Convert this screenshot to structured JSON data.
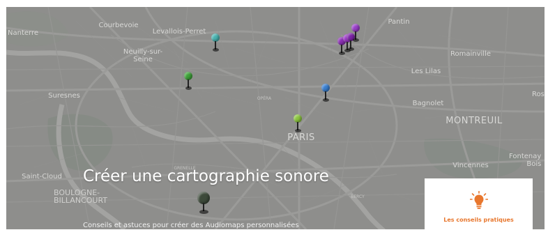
{
  "map": {
    "places": [
      {
        "id": "nanterre",
        "label": "Nanterre"
      },
      {
        "id": "courbevoie",
        "label": "Courbevoie"
      },
      {
        "id": "levallois",
        "label": "Levallois-Perret"
      },
      {
        "id": "neuilly",
        "label": "Neuilly-sur-\nSeine"
      },
      {
        "id": "pantin",
        "label": "Pantin"
      },
      {
        "id": "romainville",
        "label": "Romainville"
      },
      {
        "id": "leslilas",
        "label": "Les Lilas"
      },
      {
        "id": "suresnes",
        "label": "Suresnes"
      },
      {
        "id": "opera",
        "label": "OPÉRA"
      },
      {
        "id": "bagnolet",
        "label": "Bagnolet"
      },
      {
        "id": "montreuil",
        "label": "MONTREUIL"
      },
      {
        "id": "paris",
        "label": "PARIS"
      },
      {
        "id": "ros",
        "label": "Ros"
      },
      {
        "id": "saintcloud",
        "label": "Saint-Cloud"
      },
      {
        "id": "grenelle",
        "label": "GRENELLE"
      },
      {
        "id": "vincennes",
        "label": "Vincennes"
      },
      {
        "id": "fontenay",
        "label": "Fontenay\nBois"
      },
      {
        "id": "boulogne",
        "label": "BOULOGNE-\nBILLANCOURT"
      },
      {
        "id": "bercy",
        "label": "BERCY"
      }
    ],
    "pins": [
      {
        "id": "pin-teal",
        "color": "#49b3b0"
      },
      {
        "id": "pin-green",
        "color": "#3fa33a"
      },
      {
        "id": "pin-blue",
        "color": "#3a7fd0"
      },
      {
        "id": "pin-lime",
        "color": "#8cc63f"
      },
      {
        "id": "pin-purple-1",
        "color": "#8a2fb3"
      },
      {
        "id": "pin-purple-2",
        "color": "#9b35c6"
      },
      {
        "id": "pin-purple-3",
        "color": "#7e24a8"
      },
      {
        "id": "pin-purple-4",
        "color": "#9a3fc9"
      },
      {
        "id": "pin-dark",
        "color": "#3d4a3a"
      }
    ]
  },
  "hero": {
    "title": "Créer une cartographie sonore",
    "subtitle": "Conseils et astuces pour créer des Audiomaps personnalisées"
  },
  "tips_card": {
    "label": "Les conseils pratiques",
    "icon": "lightbulb-icon",
    "accent": "#e8772e"
  }
}
